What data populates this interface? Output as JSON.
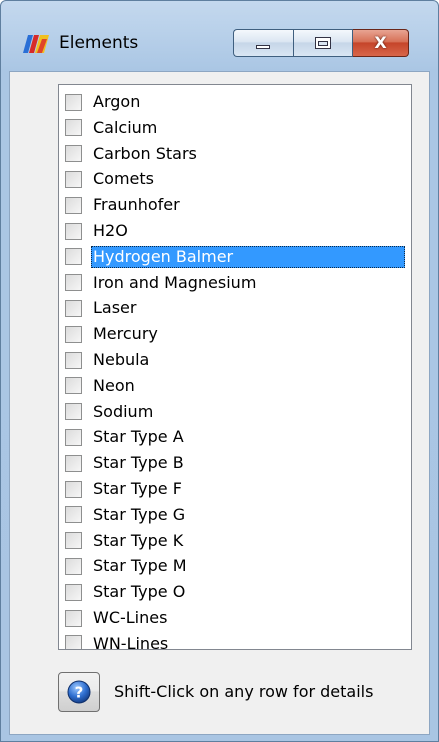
{
  "window": {
    "title": "Elements",
    "close_glyph": "X",
    "icons": [
      "spectrum-app-icon",
      "minimize-icon",
      "maximize-icon",
      "close-icon"
    ]
  },
  "list": {
    "selected_index": 6,
    "items": [
      {
        "label": "Argon",
        "checked": false
      },
      {
        "label": "Calcium",
        "checked": false
      },
      {
        "label": "Carbon Stars",
        "checked": false
      },
      {
        "label": "Comets",
        "checked": false
      },
      {
        "label": "Fraunhofer",
        "checked": false
      },
      {
        "label": "H2O",
        "checked": false
      },
      {
        "label": "Hydrogen Balmer",
        "checked": false
      },
      {
        "label": "Iron and Magnesium",
        "checked": false
      },
      {
        "label": "Laser",
        "checked": false
      },
      {
        "label": "Mercury",
        "checked": false
      },
      {
        "label": "Nebula",
        "checked": false
      },
      {
        "label": "Neon",
        "checked": false
      },
      {
        "label": "Sodium",
        "checked": false
      },
      {
        "label": "Star Type A",
        "checked": false
      },
      {
        "label": "Star Type B",
        "checked": false
      },
      {
        "label": "Star Type F",
        "checked": false
      },
      {
        "label": "Star Type G",
        "checked": false
      },
      {
        "label": "Star Type K",
        "checked": false
      },
      {
        "label": "Star Type M",
        "checked": false
      },
      {
        "label": "Star Type O",
        "checked": false
      },
      {
        "label": "WC-Lines",
        "checked": false
      },
      {
        "label": "WN-Lines",
        "checked": false
      }
    ]
  },
  "footer": {
    "help_icon": "question-mark-icon",
    "hint": "Shift-Click on any row for details"
  },
  "colors": {
    "selection": "#3399ff",
    "frame": "#b9d1ea",
    "close_button": "#c5452a"
  }
}
